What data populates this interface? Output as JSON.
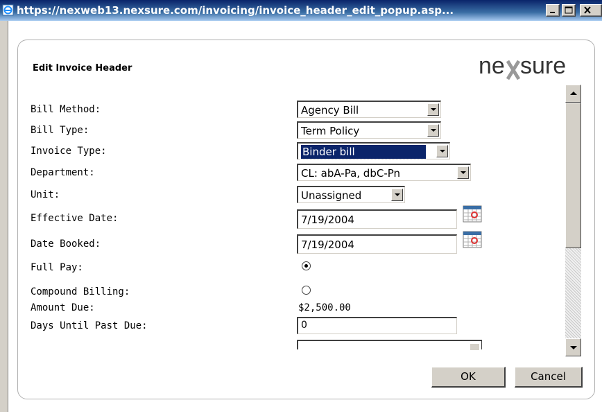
{
  "window": {
    "title": "https://nexweb13.nexsure.com/invoicing/invoice_header_edit_popup.asp..."
  },
  "dialog": {
    "title": "Edit Invoice Header",
    "logo_text": "nexsure"
  },
  "form": {
    "bill_method": {
      "label": "Bill Method:",
      "value": "Agency Bill"
    },
    "bill_type": {
      "label": "Bill Type:",
      "value": "Term Policy"
    },
    "invoice_type": {
      "label": "Invoice Type:",
      "value": "Binder bill"
    },
    "department": {
      "label": "Department:",
      "value": "CL: abA-Pa, dbC-Pn"
    },
    "unit": {
      "label": "Unit:",
      "value": "Unassigned"
    },
    "effective_date": {
      "label": "Effective Date:",
      "value": "7/19/2004"
    },
    "date_booked": {
      "label": "Date Booked:",
      "value": "7/19/2004"
    },
    "full_pay": {
      "label": "Full Pay:",
      "checked": true
    },
    "compound_billing": {
      "label": "Compound Billing:",
      "checked": false
    },
    "amount_due": {
      "label": "Amount Due:",
      "value": "$2,500.00"
    },
    "days_until_past_due": {
      "label": "Days Until Past Due:",
      "value": "0"
    },
    "extra_field": {
      "value": ""
    }
  },
  "buttons": {
    "ok": "OK",
    "cancel": "Cancel"
  },
  "icons": {
    "window": "ie-page-icon",
    "minimize": "minimize-icon",
    "maximize": "maximize-icon",
    "close": "close-icon",
    "calendar": "calendar-icon"
  },
  "colors": {
    "titlebar": "#0a246a",
    "selection": "#0a246a",
    "logo_text": "#333333",
    "logo_x": "#999999"
  }
}
